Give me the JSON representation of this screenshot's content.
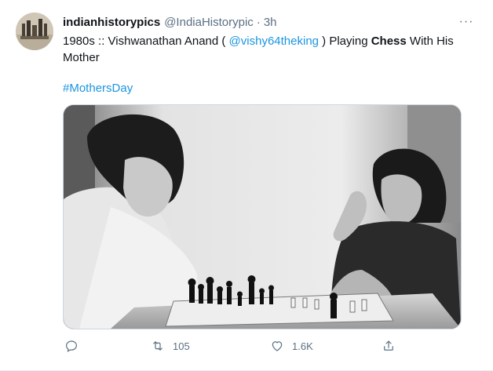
{
  "tweet": {
    "display_name": "indianhistorypics",
    "handle": "@IndiaHistorypic",
    "separator": "·",
    "time": "3h",
    "more_label": "···",
    "text": {
      "part1": "1980s :: Vishwanathan Anand ( ",
      "mention": "@vishy64theking",
      "part2": " ) Playing ",
      "bold": "Chess",
      "part3": " With His Mother"
    },
    "hashtag": "#MothersDay",
    "actions": {
      "reply_icon": "reply-icon",
      "retweet_icon": "retweet-icon",
      "retweet_count": "105",
      "like_icon": "heart-icon",
      "like_count": "1.6K",
      "share_icon": "share-icon"
    },
    "colors": {
      "link": "#1b95e0",
      "secondary": "#5b7083",
      "text": "#0f1419"
    }
  }
}
